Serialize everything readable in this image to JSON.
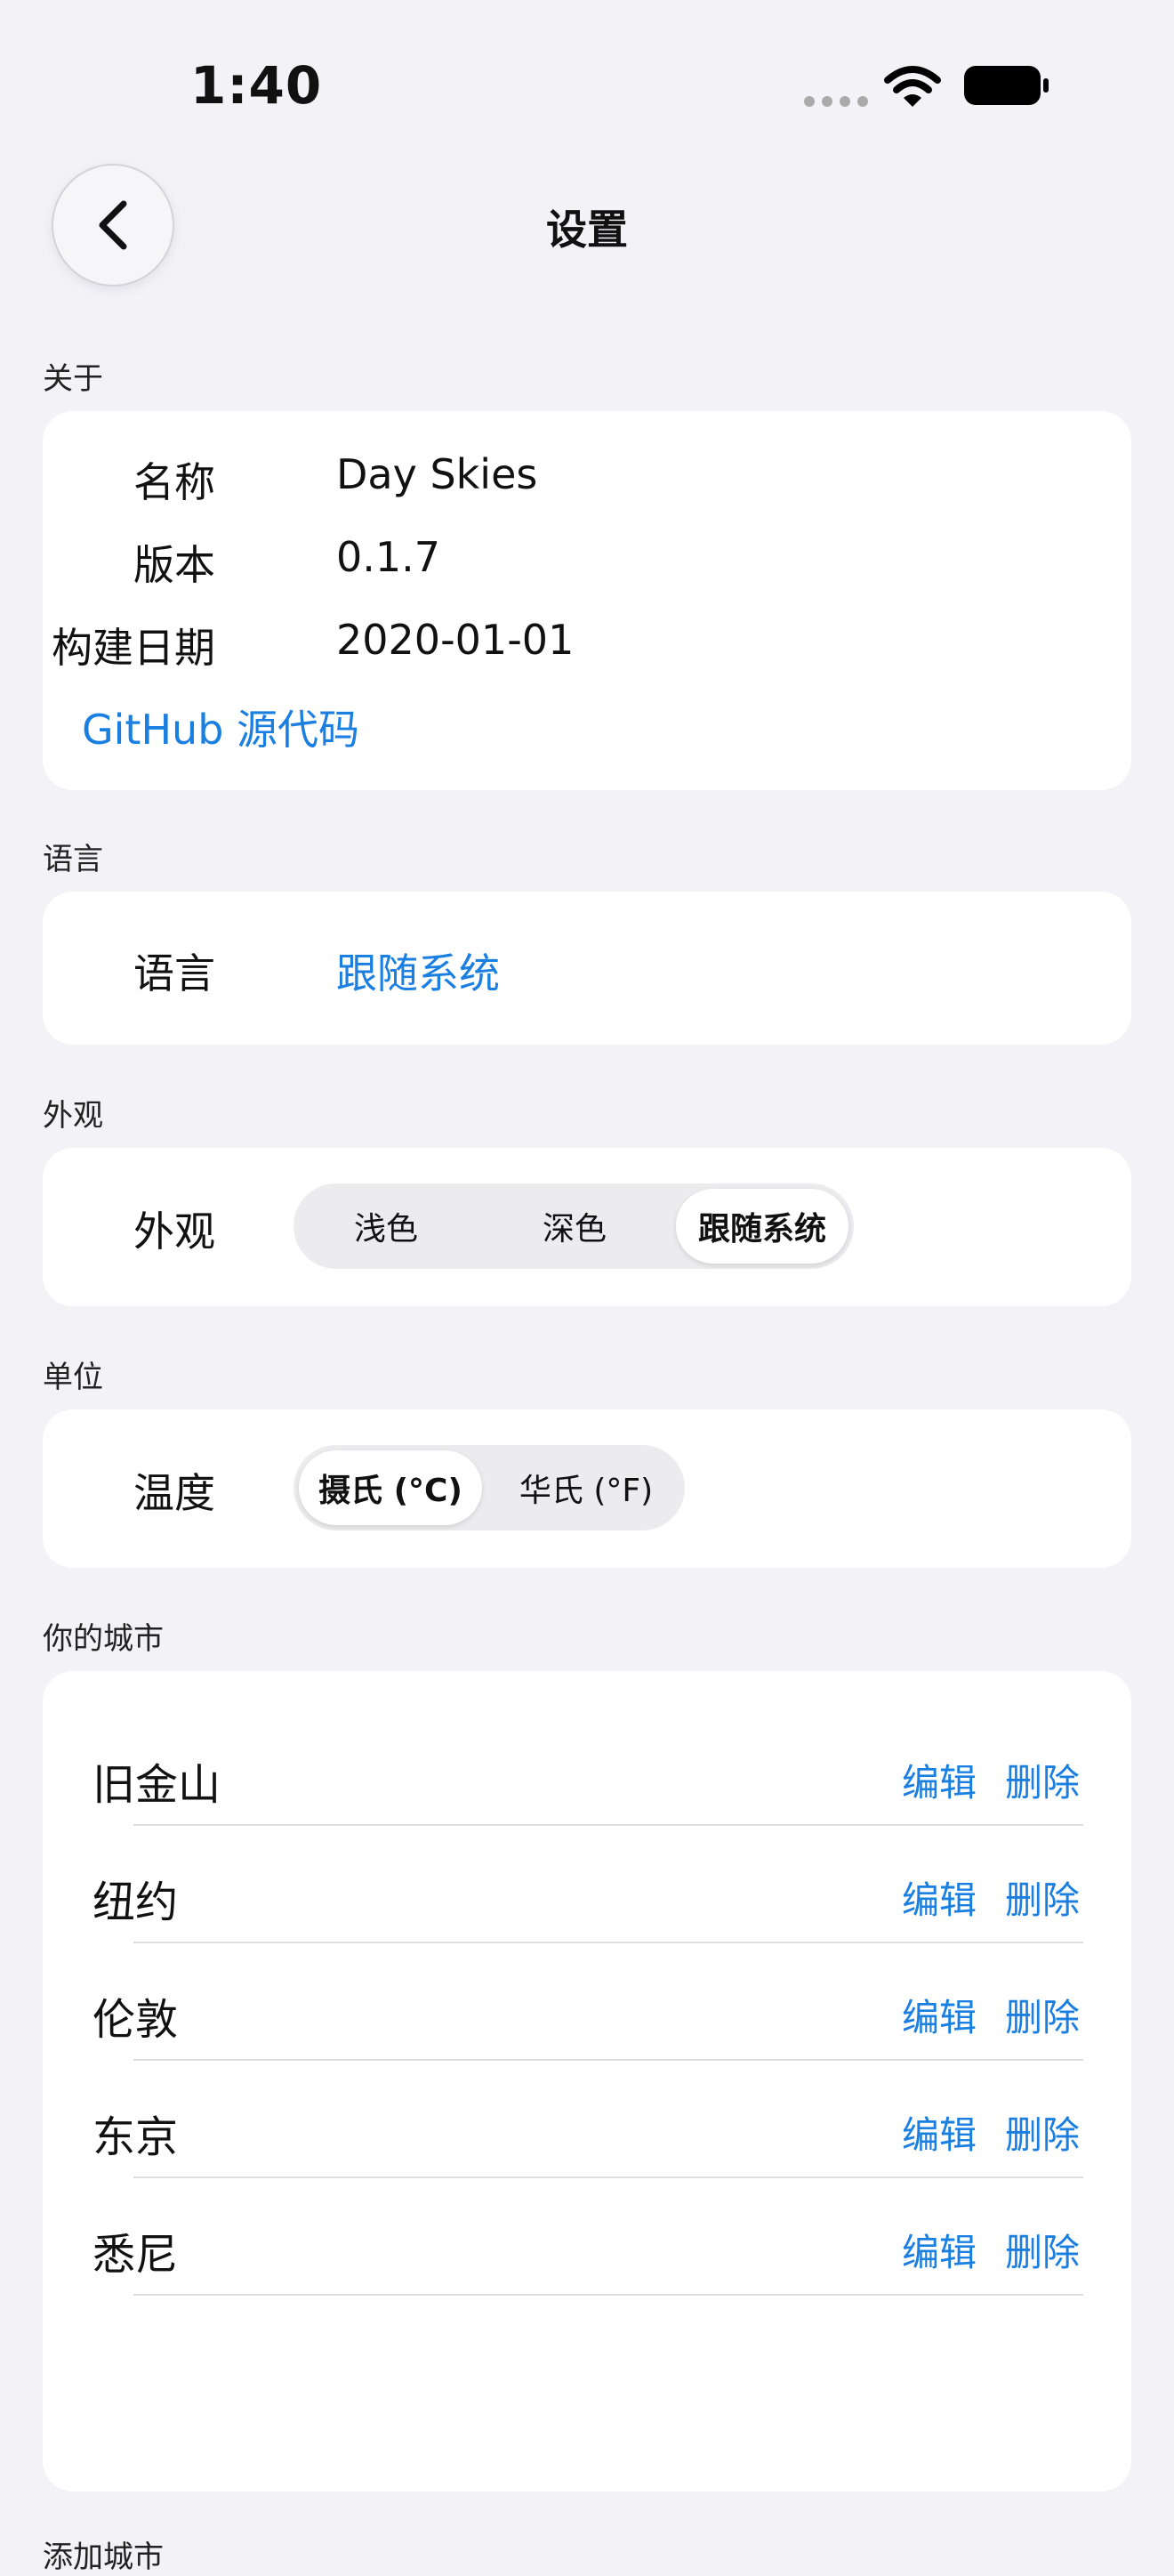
{
  "status_bar": {
    "time": "1:40"
  },
  "nav": {
    "title": "设置"
  },
  "about": {
    "header": "关于",
    "rows": [
      {
        "label": "名称",
        "value": "Day Skies"
      },
      {
        "label": "版本",
        "value": "0.1.7"
      },
      {
        "label": "构建日期",
        "value": "2020-01-01"
      }
    ],
    "github_link": "GitHub 源代码"
  },
  "language": {
    "header": "语言",
    "label": "语言",
    "value": "跟随系统"
  },
  "appearance": {
    "header": "外观",
    "label": "外观",
    "options": [
      "浅色",
      "深色",
      "跟随系统"
    ],
    "selected": "跟随系统"
  },
  "units": {
    "header": "单位",
    "label": "温度",
    "options": [
      "摄氏 (°C)",
      "华氏 (°F)"
    ],
    "selected": "摄氏 (°C)"
  },
  "cities": {
    "header": "你的城市",
    "edit_label": "编辑",
    "delete_label": "删除",
    "items": [
      {
        "name": "旧金山"
      },
      {
        "name": "纽约"
      },
      {
        "name": "伦敦"
      },
      {
        "name": "东京"
      },
      {
        "name": "悉尼"
      }
    ]
  },
  "add_city": {
    "header": "添加城市"
  },
  "colors": {
    "accent": "#1a7fe0",
    "background": "#f2f2f7",
    "card": "#ffffff"
  }
}
